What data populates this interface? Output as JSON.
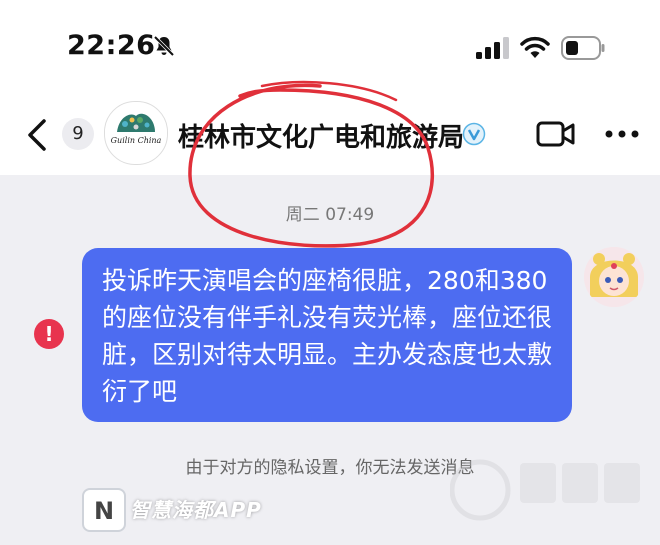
{
  "status_bar": {
    "time": "22:26",
    "icons": [
      "bell-slash-icon",
      "signal-icon",
      "wifi-icon",
      "battery-icon"
    ]
  },
  "header": {
    "back_icon": "chevron-left-icon",
    "unread_count": "9",
    "title": "桂林市文化广电和旅游局",
    "official_logo_text": "Guilin China",
    "verified_icon": "verified-badge-icon",
    "video_icon": "video-call-icon",
    "more_icon": "more-dots-icon"
  },
  "chat": {
    "timestamp": "周二 07:49",
    "message": "投诉昨天演唱会的座椅很脏，280和380的座位没有伴手礼没有荧光棒，座位还很脏，区别对待太明显。主办发态度也太敷衍了吧",
    "error_icon": "send-failed-icon",
    "error_glyph": "!",
    "privacy_notice": "由于对方的隐私设置，你无法发送消息"
  },
  "watermark": {
    "logo_letter": "N",
    "text": "智慧海都APP"
  },
  "colors": {
    "bubble": "#4d6cf1",
    "annotation": "#e0303a",
    "error": "#e8344e",
    "background": "#efeff3"
  }
}
